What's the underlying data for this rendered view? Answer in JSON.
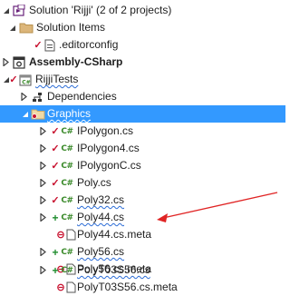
{
  "solution_explorer": {
    "rows": [
      {
        "label": "Solution 'Rijji' (2 of 2 projects)",
        "icon": "solution-icon",
        "status": "none",
        "chevron": "down",
        "squiggle": false,
        "bold": false
      },
      {
        "label": "Solution Items",
        "icon": "folder-icon",
        "status": "none",
        "chevron": "down",
        "squiggle": false,
        "bold": false
      },
      {
        "label": ".editorconfig",
        "icon": "config-file-icon",
        "status": "checked-in",
        "chevron": "none",
        "squiggle": false,
        "bold": false
      },
      {
        "label": "Assembly-CSharp",
        "icon": "csharp-project-icon",
        "status": "none",
        "chevron": "right",
        "squiggle": false,
        "bold": true
      },
      {
        "label": "RijjiTests",
        "icon": "csharp-project-icon",
        "status": "checked-in",
        "chevron": "down",
        "squiggle": true,
        "bold": false
      },
      {
        "label": "Dependencies",
        "icon": "dependencies-icon",
        "status": "none",
        "chevron": "right",
        "squiggle": false,
        "bold": false
      },
      {
        "label": "Graphics",
        "icon": "folder-icon",
        "status": "none",
        "chevron": "down",
        "squiggle": true,
        "bold": false,
        "selected": true
      },
      {
        "label": "IPolygon.cs",
        "icon": "csharp-file-icon",
        "status": "checked-in",
        "chevron": "right",
        "squiggle": false,
        "bold": false
      },
      {
        "label": "IPolygon4.cs",
        "icon": "csharp-file-icon",
        "status": "checked-in",
        "chevron": "right",
        "squiggle": false,
        "bold": false
      },
      {
        "label": "IPolygonC.cs",
        "icon": "csharp-file-icon",
        "status": "checked-in",
        "chevron": "right",
        "squiggle": false,
        "bold": false
      },
      {
        "label": "Poly.cs",
        "icon": "csharp-file-icon",
        "status": "checked-in",
        "chevron": "right",
        "squiggle": false,
        "bold": false
      },
      {
        "label": "Poly32.cs",
        "icon": "csharp-file-icon",
        "status": "checked-in",
        "chevron": "right",
        "squiggle": true,
        "bold": false
      },
      {
        "label": "Poly44.cs",
        "icon": "csharp-file-icon",
        "status": "added",
        "chevron": "right",
        "squiggle": true,
        "bold": false
      },
      {
        "label": "Poly44.cs.meta",
        "icon": "meta-file-icon",
        "status": "ignored",
        "chevron": "none",
        "squiggle": false,
        "bold": false
      },
      {
        "label": "Poly56.cs",
        "icon": "csharp-file-icon",
        "status": "added",
        "chevron": "right",
        "squiggle": true,
        "bold": false
      },
      {
        "label": "Poly56.cs.meta",
        "icon": "meta-file-icon",
        "status": "ignored",
        "chevron": "none",
        "squiggle": false,
        "bold": false
      },
      {
        "label": "PolyT03S56.cs",
        "icon": "csharp-file-icon",
        "status": "added",
        "chevron": "right",
        "squiggle": true,
        "bold": false
      },
      {
        "label": "PolyT03S56.cs.meta",
        "icon": "meta-file-icon",
        "status": "ignored",
        "chevron": "none",
        "squiggle": false,
        "bold": false
      }
    ],
    "annotation": {
      "icon": "red-arrow-icon",
      "points_to": "Poly44.cs.meta"
    },
    "colors": {
      "selection": "#3399ff",
      "checked_in": "#c8102e",
      "added": "#1e8c2d",
      "arrow": "#e02424",
      "csharp": "#3a8a2a"
    }
  }
}
